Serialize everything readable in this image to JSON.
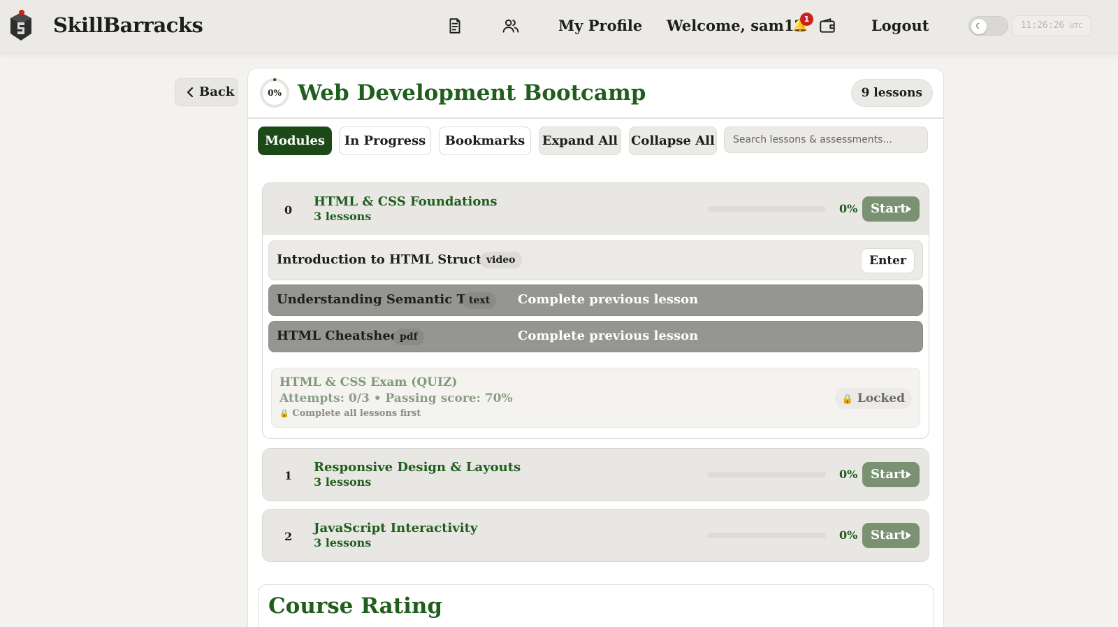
{
  "header": {
    "brand": "SkillBarracks",
    "my_profile": "My Profile",
    "welcome": "Welcome, sam12",
    "notification_count": "1",
    "logout": "Logout",
    "clock_time": "11:26:26",
    "clock_zone": "UTC",
    "icons": [
      "logo-icon",
      "courses-icon",
      "users-icon",
      "bell-icon",
      "wallet-icon",
      "moon-icon"
    ]
  },
  "back_label": "Back",
  "course": {
    "progress_label": "0%",
    "progress": 0,
    "title": "Web Development Bootcamp",
    "lessons_count": "9 lessons"
  },
  "tabs": [
    {
      "label": "Modules",
      "active": true
    },
    {
      "label": "In Progress",
      "active": false
    },
    {
      "label": "Bookmarks",
      "active": false
    },
    {
      "label": "Expand All",
      "active": false
    },
    {
      "label": "Collapse All",
      "active": false
    }
  ],
  "search": {
    "placeholder": "Search lessons & assessments..."
  },
  "modules": [
    {
      "number": "0",
      "title": "HTML & CSS Foundations",
      "subtitle": "3 lessons",
      "progress": 0,
      "percent": "0%",
      "action": "Start",
      "lessons": [
        {
          "name": "Introduction to HTML Structure",
          "tag": "video",
          "state": "open",
          "action": "Enter"
        },
        {
          "name": "Understanding Semantic Tags",
          "tag": "text",
          "state": "locked",
          "note": "Complete previous lesson"
        },
        {
          "name": "HTML Cheatsheet",
          "tag": "pdf",
          "state": "locked",
          "note": "Complete previous lesson"
        }
      ],
      "quiz": {
        "title": "HTML & CSS Exam (QUIZ)",
        "meta": "Attempts: 0/3 • Passing score: 70%",
        "hint": "Complete all lessons first",
        "status": "Locked"
      }
    },
    {
      "number": "1",
      "title": "Responsive Design & Layouts",
      "subtitle": "3 lessons",
      "progress": 0,
      "percent": "0%",
      "action": "Start"
    },
    {
      "number": "2",
      "title": "JavaScript Interactivity",
      "subtitle": "3 lessons",
      "progress": 0,
      "percent": "0%",
      "action": "Start"
    }
  ],
  "rating": {
    "title": "Course Rating"
  },
  "colors": {
    "brand_green": "#1f5e1d",
    "active_tab": "#1b4a18",
    "start_button": "#7a9272",
    "badge_red": "#c8231f"
  }
}
